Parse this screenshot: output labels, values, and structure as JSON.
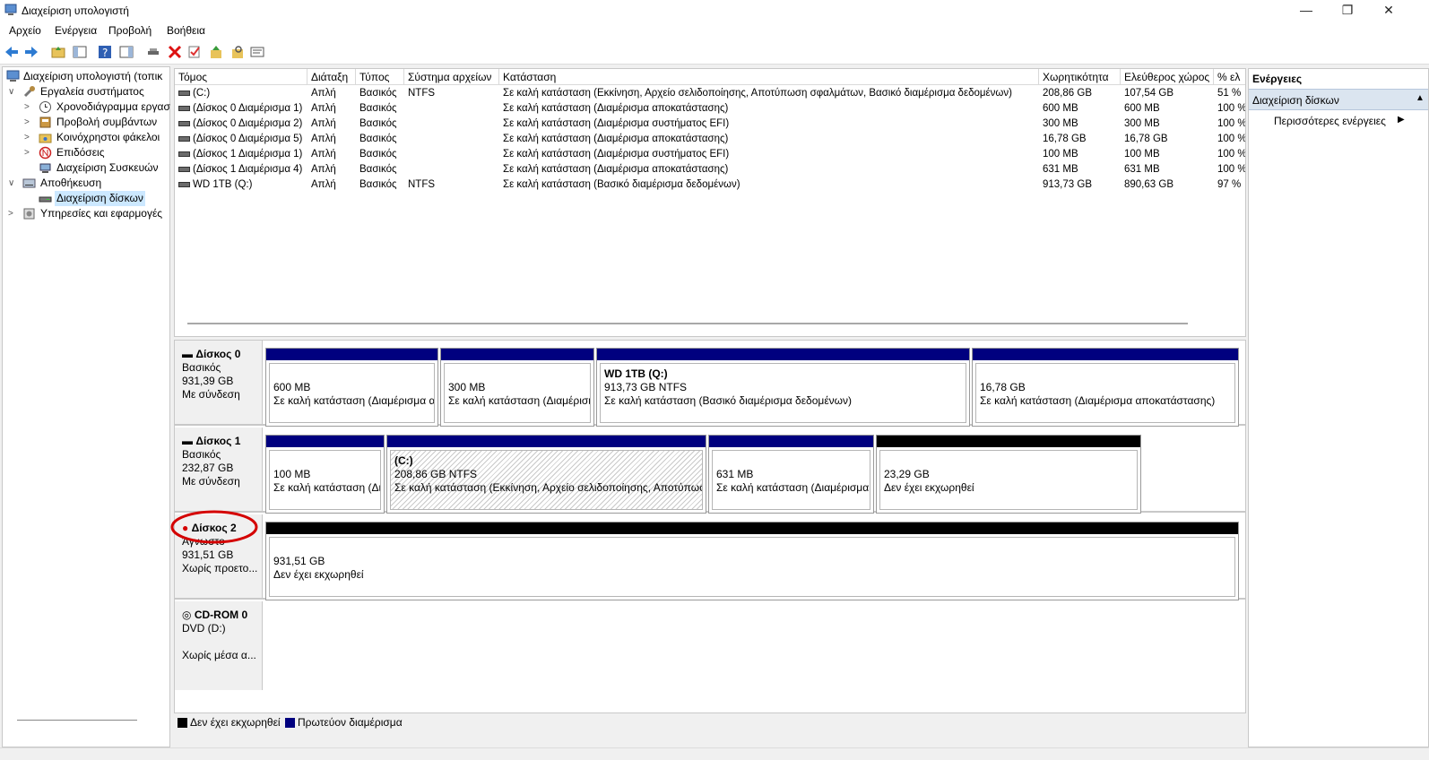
{
  "window": {
    "title": "Διαχείριση υπολογιστή"
  },
  "menu": [
    "Αρχείο",
    "Ενέργεια",
    "Προβολή",
    "Βοήθεια"
  ],
  "tree": [
    {
      "label": "Διαχείριση υπολογιστή (τοπικ",
      "icon": "computer-management-icon",
      "level": 0,
      "expander": ""
    },
    {
      "label": "Εργαλεία συστήματος",
      "icon": "tools-icon",
      "level": 1,
      "expander": "v"
    },
    {
      "label": "Χρονοδιάγραμμα εργασ",
      "icon": "clock-icon",
      "level": 2,
      "expander": ">"
    },
    {
      "label": "Προβολή συμβάντων",
      "icon": "event-viewer-icon",
      "level": 2,
      "expander": ">"
    },
    {
      "label": "Κοινόχρηστοι φάκελοι",
      "icon": "shared-folder-icon",
      "level": 2,
      "expander": ">"
    },
    {
      "label": "Επιδόσεις",
      "icon": "performance-icon",
      "level": 2,
      "expander": ">"
    },
    {
      "label": "Διαχείριση Συσκευών",
      "icon": "device-manager-icon",
      "level": 2,
      "expander": ""
    },
    {
      "label": "Αποθήκευση",
      "icon": "storage-icon",
      "level": 1,
      "expander": "v"
    },
    {
      "label": "Διαχείριση δίσκων",
      "icon": "disk-management-icon",
      "level": 2,
      "expander": "",
      "selected": true
    },
    {
      "label": "Υπηρεσίες και εφαρμογές",
      "icon": "services-icon",
      "level": 1,
      "expander": ">"
    }
  ],
  "volumes": {
    "columns": [
      "Τόμος",
      "Διάταξη",
      "Τύπος",
      "Σύστημα αρχείων",
      "Κατάσταση",
      "Χωρητικότητα",
      "Ελεύθερος χώρος",
      "% ελ"
    ],
    "rows": [
      [
        "(C:)",
        "Απλή",
        "Βασικός",
        "NTFS",
        "Σε καλή κατάσταση (Εκκίνηση, Αρχείο σελιδοποίησης, Αποτύπωση σφαλμάτων, Βασικό διαμέρισμα δεδομένων)",
        "208,86 GB",
        "107,54 GB",
        "51 %"
      ],
      [
        "(Δίσκος 0 Διαμέρισμα 1)",
        "Απλή",
        "Βασικός",
        "",
        "Σε καλή κατάσταση (Διαμέρισμα αποκατάστασης)",
        "600 MB",
        "600 MB",
        "100 %"
      ],
      [
        "(Δίσκος 0 Διαμέρισμα 2)",
        "Απλή",
        "Βασικός",
        "",
        "Σε καλή κατάσταση (Διαμέρισμα συστήματος EFI)",
        "300 MB",
        "300 MB",
        "100 %"
      ],
      [
        "(Δίσκος 0 Διαμέρισμα 5)",
        "Απλή",
        "Βασικός",
        "",
        "Σε καλή κατάσταση (Διαμέρισμα αποκατάστασης)",
        "16,78 GB",
        "16,78 GB",
        "100 %"
      ],
      [
        "(Δίσκος 1 Διαμέρισμα 1)",
        "Απλή",
        "Βασικός",
        "",
        "Σε καλή κατάσταση (Διαμέρισμα συστήματος EFI)",
        "100 MB",
        "100 MB",
        "100 %"
      ],
      [
        "(Δίσκος 1 Διαμέρισμα 4)",
        "Απλή",
        "Βασικός",
        "",
        "Σε καλή κατάσταση (Διαμέρισμα αποκατάστασης)",
        "631 MB",
        "631 MB",
        "100 %"
      ],
      [
        "WD 1TB (Q:)",
        "Απλή",
        "Βασικός",
        "NTFS",
        "Σε καλή κατάσταση (Βασικό διαμέρισμα δεδομένων)",
        "913,73 GB",
        "890,63 GB",
        "97 %"
      ]
    ]
  },
  "disks": [
    {
      "name": "Δίσκος 0",
      "type": "Βασικός",
      "size": "931,39 GB",
      "status": "Με σύνδεση",
      "partitions": [
        {
          "title": "",
          "size": "600 MB",
          "status": "Σε καλή κατάσταση (Διαμέρισμα α",
          "kind": "primary"
        },
        {
          "title": "",
          "size": "300 MB",
          "status": "Σε καλή κατάσταση (Διαμέρισι",
          "kind": "primary"
        },
        {
          "title": "WD 1TB  (Q:)",
          "size": "913,73 GB NTFS",
          "status": "Σε καλή κατάσταση (Βασικό διαμέρισμα δεδομένων)",
          "kind": "primary"
        },
        {
          "title": "",
          "size": "16,78 GB",
          "status": "Σε καλή κατάσταση (Διαμέρισμα αποκατάστασης)",
          "kind": "primary"
        }
      ]
    },
    {
      "name": "Δίσκος 1",
      "type": "Βασικός",
      "size": "232,87 GB",
      "status": "Με σύνδεση",
      "partitions": [
        {
          "title": "",
          "size": "100 MB",
          "status": "Σε καλή κατάσταση (Δι",
          "kind": "primary"
        },
        {
          "title": "(C:)",
          "size": "208,86 GB NTFS",
          "status": "Σε καλή κατάσταση (Εκκίνηση, Αρχείο σελιδοποίησης, Αποτύπωσ",
          "kind": "primary",
          "hatched": true
        },
        {
          "title": "",
          "size": "631 MB",
          "status": "Σε καλή κατάσταση (Διαμέρισμα",
          "kind": "primary"
        },
        {
          "title": "",
          "size": "23,29 GB",
          "status": "Δεν έχει εκχωρηθεί",
          "kind": "unallocated"
        }
      ]
    },
    {
      "name": "Δίσκος 2",
      "type": "Άγνωστο",
      "size": "931,51 GB",
      "status": "Χωρίς προετο...",
      "partitions": [
        {
          "title": "",
          "size": "931,51 GB",
          "status": "Δεν έχει εκχωρηθεί",
          "kind": "unallocated"
        }
      ]
    },
    {
      "name": "CD-ROM 0",
      "type": "DVD (D:)",
      "size": "",
      "status": "Χωρίς μέσα α..."
    }
  ],
  "legend": [
    "Δεν έχει εκχωρηθεί",
    "Πρωτεύον διαμέρισμα"
  ],
  "actions": {
    "header": "Ενέργειες",
    "section": "Διαχείριση δίσκων",
    "more": "Περισσότερες ενέργειες"
  },
  "colors": {
    "primary": "#00007f",
    "unallocated": "#000000",
    "highlight": "#d40000",
    "selection": "#cce8ff",
    "section": "#dbe5f0"
  }
}
